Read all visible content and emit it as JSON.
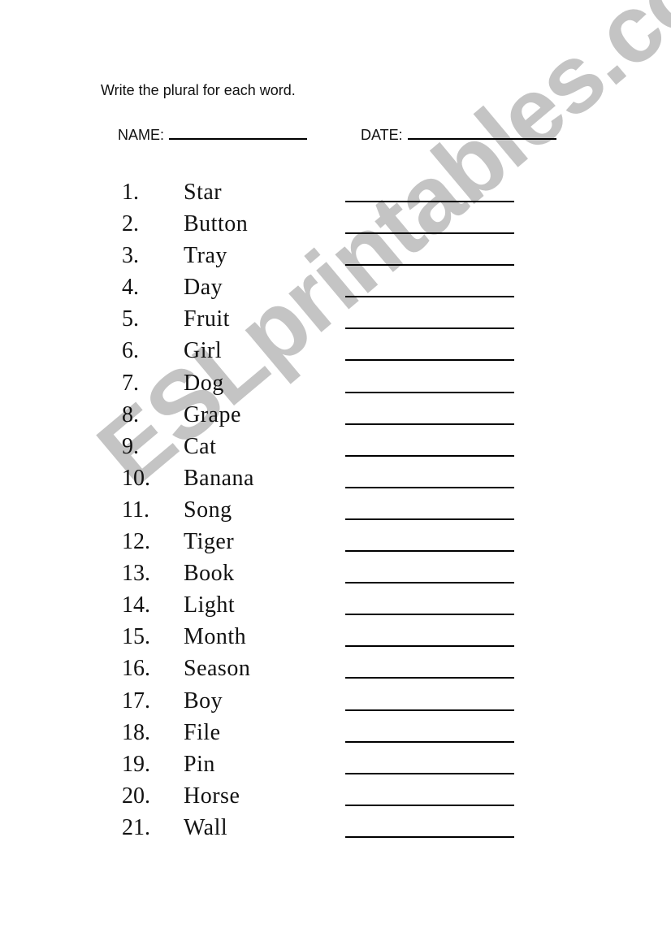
{
  "instruction": "Write the plural for each word.",
  "name_label": "NAME:",
  "date_label": "DATE:",
  "watermark": "ESLprintables.com",
  "colors": {
    "text": "#111111",
    "watermark": "#c4c4c4",
    "background": "#ffffff"
  },
  "items": [
    {
      "number": "1.",
      "word": "Star"
    },
    {
      "number": "2.",
      "word": "Button"
    },
    {
      "number": "3.",
      "word": "Tray"
    },
    {
      "number": "4.",
      "word": "Day"
    },
    {
      "number": "5.",
      "word": "Fruit"
    },
    {
      "number": "6.",
      "word": "Girl"
    },
    {
      "number": "7.",
      "word": "Dog"
    },
    {
      "number": "8.",
      "word": "Grape"
    },
    {
      "number": "9.",
      "word": "Cat"
    },
    {
      "number": "10.",
      "word": "Banana"
    },
    {
      "number": "11.",
      "word": "Song"
    },
    {
      "number": "12.",
      "word": "Tiger"
    },
    {
      "number": "13.",
      "word": "Book"
    },
    {
      "number": "14.",
      "word": "Light"
    },
    {
      "number": "15.",
      "word": "Month"
    },
    {
      "number": "16.",
      "word": "Season"
    },
    {
      "number": "17.",
      "word": "Boy"
    },
    {
      "number": "18.",
      "word": "File"
    },
    {
      "number": "19.",
      "word": "Pin"
    },
    {
      "number": "20.",
      "word": "Horse"
    },
    {
      "number": "21.",
      "word": "Wall"
    }
  ]
}
